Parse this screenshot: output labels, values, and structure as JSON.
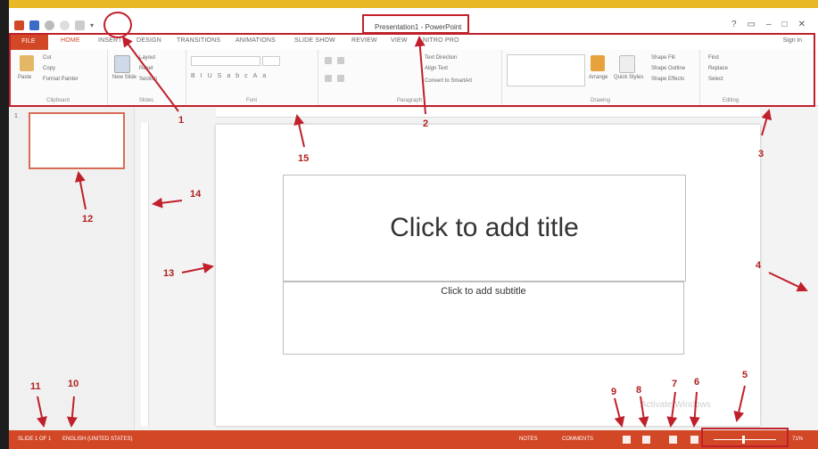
{
  "window": {
    "title": "Presentation1 - PowerPoint"
  },
  "tabs": [
    "FILE",
    "HOME",
    "INSERT",
    "DESIGN",
    "TRANSITIONS",
    "ANIMATIONS",
    "SLIDE SHOW",
    "REVIEW",
    "VIEW",
    "NITRO PRO"
  ],
  "active_tab": "HOME",
  "signin": "Sign in",
  "ribbon": {
    "clipboard": {
      "label": "Clipboard",
      "paste": "Paste",
      "cut": "Cut",
      "copy": "Copy",
      "format_painter": "Format Painter"
    },
    "slides": {
      "label": "Slides",
      "new_slide": "New Slide",
      "layout": "Layout",
      "reset": "Reset",
      "section": "Section"
    },
    "font": {
      "label": "Font"
    },
    "paragraph": {
      "label": "Paragraph",
      "text_direction": "Text Direction",
      "align_text": "Align Text",
      "convert_smartart": "Convert to SmartArt"
    },
    "drawing": {
      "label": "Drawing",
      "arrange": "Arrange",
      "quick_styles": "Quick Styles",
      "shape_fill": "Shape Fill",
      "shape_outline": "Shape Outline",
      "shape_effects": "Shape Effects"
    },
    "editing": {
      "label": "Editing",
      "find": "Find",
      "replace": "Replace",
      "select": "Select"
    }
  },
  "slide_panel": {
    "slide_number": "1"
  },
  "slide": {
    "title_placeholder": "Click to add title",
    "subtitle_placeholder": "Click to add subtitle"
  },
  "watermark": "Activate Windows",
  "status": {
    "slide_of": "SLIDE 1 OF 1",
    "language": "ENGLISH (UNITED STATES)",
    "notes": "NOTES",
    "comments": "COMMENTS",
    "zoom": "71%"
  },
  "annotations": [
    "1",
    "2",
    "3",
    "4",
    "5",
    "6",
    "7",
    "8",
    "9",
    "10",
    "11",
    "12",
    "13",
    "14",
    "15"
  ],
  "colors": {
    "accent": "#d24726",
    "annotation": "#c0202b"
  }
}
